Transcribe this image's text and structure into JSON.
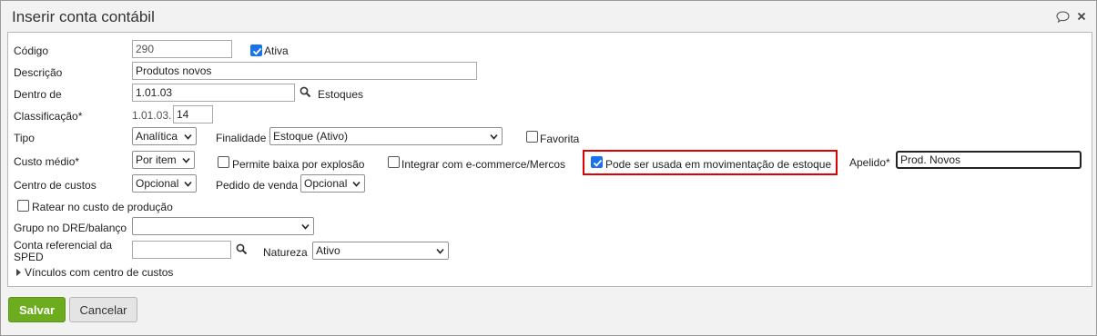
{
  "dialog": {
    "title": "Inserir conta contábil",
    "icons": {
      "comment": "comment-icon",
      "close": "close-icon"
    }
  },
  "form": {
    "codigo": {
      "label": "Código",
      "value": "290"
    },
    "ativa": {
      "label": "Ativa",
      "checked": true
    },
    "descricao": {
      "label": "Descrição",
      "value": "Produtos novos"
    },
    "dentro_de": {
      "label": "Dentro de",
      "value": "1.01.03",
      "lookup_text": "Estoques"
    },
    "classificacao": {
      "label": "Classificação*",
      "prefix": "1.01.03.",
      "value": "14"
    },
    "tipo": {
      "label": "Tipo",
      "value": "Analítica"
    },
    "finalidade": {
      "label": "Finalidade",
      "value": "Estoque (Ativo)"
    },
    "favorita": {
      "label": "Favorita",
      "checked": false
    },
    "custo_medio": {
      "label": "Custo médio*",
      "value": "Por item"
    },
    "permite_baixa": {
      "label": "Permite baixa por explosão",
      "checked": false
    },
    "integrar_ecommerce": {
      "label": "Integrar com e-commerce/Mercos",
      "checked": false
    },
    "pode_ser_usada": {
      "label": "Pode ser usada em movimentação de estoque",
      "checked": true
    },
    "apelido": {
      "label": "Apelido*",
      "value": "Prod. Novos"
    },
    "centro_custos": {
      "label": "Centro de custos",
      "value": "Opcional"
    },
    "pedido_venda": {
      "label": "Pedido de venda",
      "value": "Opcional"
    },
    "ratear": {
      "label": "Ratear no custo de produção",
      "checked": false
    },
    "grupo_dre": {
      "label": "Grupo no DRE/balanço",
      "value": ""
    },
    "conta_sped": {
      "label_line1": "Conta referencial da",
      "label_line2": "SPED",
      "value": ""
    },
    "natureza": {
      "label": "Natureza",
      "value": "Ativo"
    },
    "vinculos": {
      "label": "Vínculos com centro de custos"
    }
  },
  "buttons": {
    "save": "Salvar",
    "cancel": "Cancelar"
  },
  "colors": {
    "save_bg": "#6cac1e",
    "highlight": "#e00000",
    "checkbox_on": "#1a73e8"
  }
}
